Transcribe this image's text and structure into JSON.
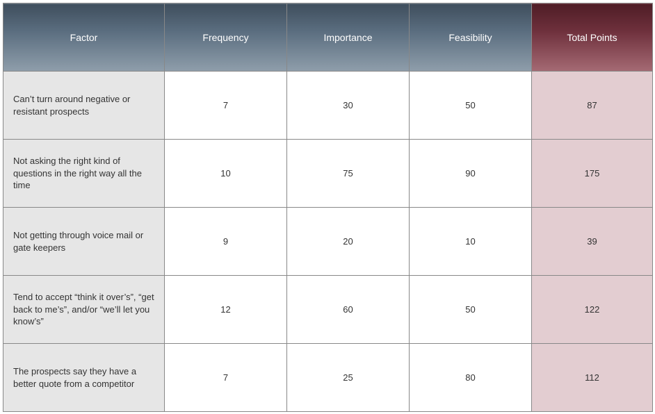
{
  "chart_data": {
    "type": "table",
    "columns": [
      "Factor",
      "Frequency",
      "Importance",
      "Feasibility",
      "Total Points"
    ],
    "rows": [
      {
        "factor": "Can’t turn around negative or resistant prospects",
        "frequency": 7,
        "importance": 30,
        "feasibility": 50,
        "total": 87
      },
      {
        "factor": "Not asking the right kind of questions in the right way all the time",
        "frequency": 10,
        "importance": 75,
        "feasibility": 90,
        "total": 175
      },
      {
        "factor": "Not getting through voice mail or gate keepers",
        "frequency": 9,
        "importance": 20,
        "feasibility": 10,
        "total": 39
      },
      {
        "factor": "Tend to accept “think it over’s”, “get back to me’s”, and/or “we’ll let you know’s”",
        "frequency": 12,
        "importance": 60,
        "feasibility": 50,
        "total": 122
      },
      {
        "factor": "The prospects say they have a better quote from a competitor",
        "frequency": 7,
        "importance": 25,
        "feasibility": 80,
        "total": 112
      }
    ]
  }
}
